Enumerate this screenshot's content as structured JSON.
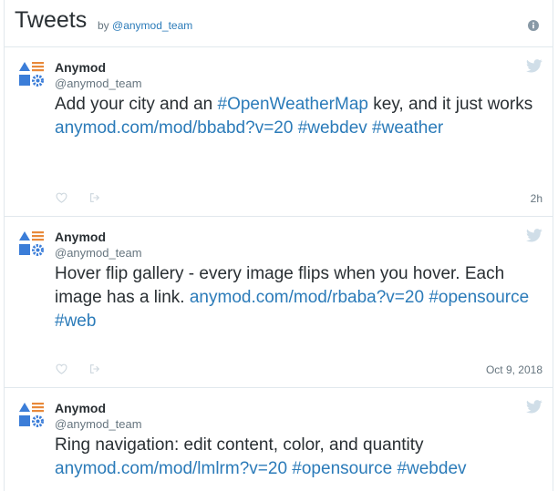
{
  "header": {
    "title": "Tweets",
    "by_prefix": "by",
    "by_handle": "@anymod_team",
    "info_icon": "info-icon"
  },
  "tweets": [
    {
      "name": "Anymod",
      "handle": "@anymod_team",
      "parts": [
        {
          "text": "Add your city and an ",
          "link": false
        },
        {
          "text": "#OpenWeatherMap",
          "link": true
        },
        {
          "text": " key, and it just works ",
          "link": false
        },
        {
          "text": "anymod.com/mod/bbabd?v=20",
          "link": true
        },
        {
          "text": " ",
          "link": false
        },
        {
          "text": "#webdev",
          "link": true
        },
        {
          "text": " ",
          "link": false
        },
        {
          "text": "#weather",
          "link": true
        }
      ],
      "time": "2h"
    },
    {
      "name": "Anymod",
      "handle": "@anymod_team",
      "parts": [
        {
          "text": "Hover flip gallery - every image flips when you hover. Each image has a link. ",
          "link": false
        },
        {
          "text": "anymod.com/mod/rbaba?v=20",
          "link": true
        },
        {
          "text": " ",
          "link": false
        },
        {
          "text": "#opensource",
          "link": true
        },
        {
          "text": " ",
          "link": false
        },
        {
          "text": "#web",
          "link": true
        }
      ],
      "time": "Oct 9, 2018"
    },
    {
      "name": "Anymod",
      "handle": "@anymod_team",
      "parts": [
        {
          "text": "Ring navigation: edit content, color, and quantity ",
          "link": false
        },
        {
          "text": "anymod.com/mod/lmlrm?v=20",
          "link": true
        },
        {
          "text": " ",
          "link": false
        },
        {
          "text": "#opensource",
          "link": true
        },
        {
          "text": " ",
          "link": false
        },
        {
          "text": "#webdev",
          "link": true
        }
      ],
      "time": ""
    }
  ],
  "icons": {
    "avatar": "anymod-logo-icon",
    "bird": "twitter-bird-icon",
    "like": "heart-icon",
    "share": "share-icon"
  },
  "colors": {
    "text": "#292f33",
    "muted": "#66757f",
    "link": "#2b7bb9",
    "border": "#e1e8ed",
    "bird": "#d0dee8",
    "logo_blue": "#3b7dd8",
    "logo_orange": "#e8893a"
  }
}
